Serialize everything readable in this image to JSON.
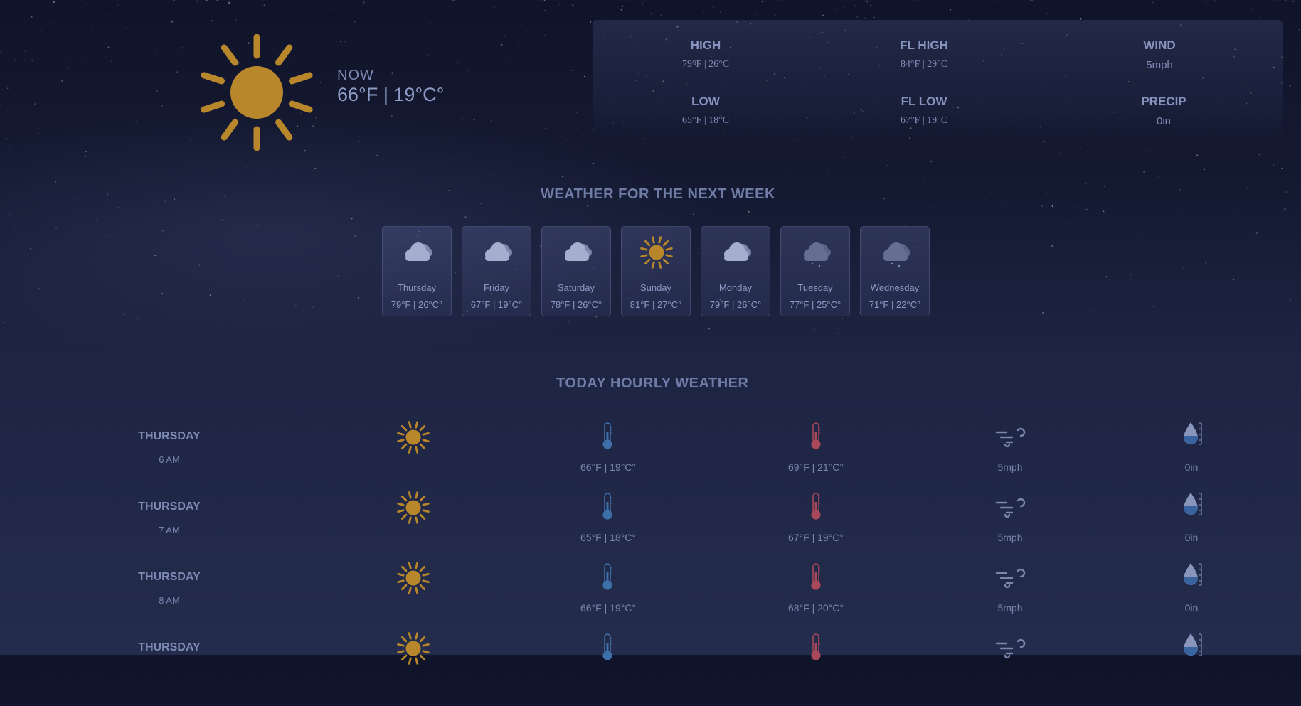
{
  "current": {
    "label": "NOW",
    "temp": "66°F | 19°C°",
    "icon": "sun-icon"
  },
  "stats": [
    {
      "label": "HIGH",
      "value": "79°F | 26°C"
    },
    {
      "label": "FL HIGH",
      "value": "84°F | 29°C"
    },
    {
      "label": "WIND",
      "value": "5mph"
    },
    {
      "label": "LOW",
      "value": "65°F | 18°C"
    },
    {
      "label": "FL LOW",
      "value": "67°F | 19°C"
    },
    {
      "label": "PRECIP",
      "value": "0in"
    }
  ],
  "week": {
    "heading": "WEATHER FOR THE NEXT WEEK",
    "days": [
      {
        "day": "Thursday",
        "temp": "79°F | 26°C°",
        "icon": "cloud-icon"
      },
      {
        "day": "Friday",
        "temp": "67°F | 19°C°",
        "icon": "cloud-icon"
      },
      {
        "day": "Saturday",
        "temp": "78°F | 26°C°",
        "icon": "cloud-icon"
      },
      {
        "day": "Sunday",
        "temp": "81°F | 27°C°",
        "icon": "sun-icon"
      },
      {
        "day": "Monday",
        "temp": "79°F | 26°C°",
        "icon": "cloud-icon"
      },
      {
        "day": "Tuesday",
        "temp": "77°F | 25°C°",
        "icon": "rain-cloud-icon"
      },
      {
        "day": "Wednesday",
        "temp": "71°F | 22°C°",
        "icon": "rain-cloud-icon"
      }
    ]
  },
  "hourly": {
    "heading": "TODAY HOURLY WEATHER",
    "rows": [
      {
        "day": "THURSDAY",
        "time": "6 AM",
        "temp": "66°F | 19°C°",
        "feels": "69°F | 21°C°",
        "wind": "5mph",
        "precip": "0in"
      },
      {
        "day": "THURSDAY",
        "time": "7 AM",
        "temp": "65°F | 18°C°",
        "feels": "67°F | 19°C°",
        "wind": "5mph",
        "precip": "0in"
      },
      {
        "day": "THURSDAY",
        "time": "8 AM",
        "temp": "66°F | 19°C°",
        "feels": "68°F | 20°C°",
        "wind": "5mph",
        "precip": "0in"
      },
      {
        "day": "THURSDAY",
        "time": "",
        "temp": "",
        "feels": "",
        "wind": "",
        "precip": ""
      }
    ]
  },
  "colors": {
    "sun": "#b8872c",
    "cloud": "#a6aed0",
    "thermo_blue": "#3d6fa8",
    "thermo_red": "#a8485a",
    "drop_blue": "#3a64a0"
  }
}
